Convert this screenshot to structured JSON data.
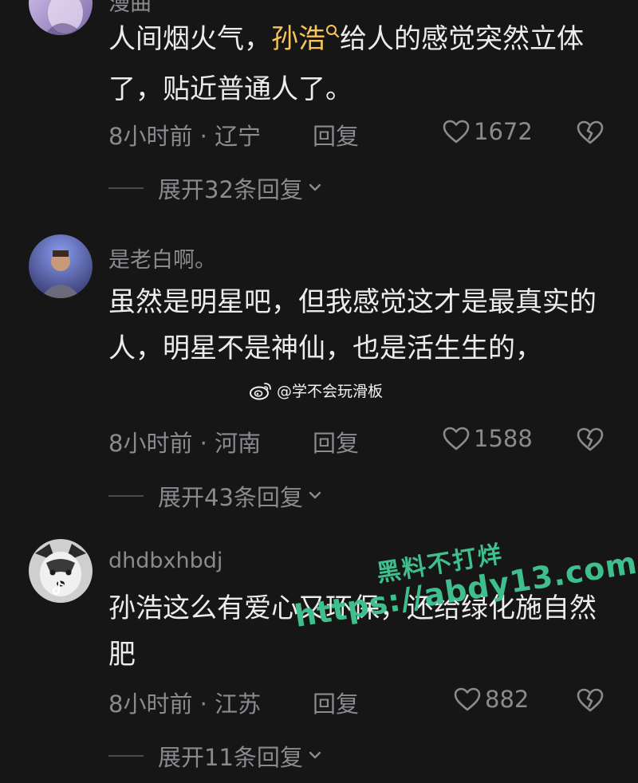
{
  "comments": [
    {
      "username": "漫曲",
      "text_before": "人间烟火气，",
      "highlight": "孙浩",
      "text_after": "给人的感觉突然立体了，贴近普通人了。",
      "time_location": "8小时前 · 辽宁",
      "reply_label": "回复",
      "likes": "1672",
      "expand_label": "展开32条回复",
      "avatar_colors": [
        "#c9b7e8",
        "#8f7bb8"
      ]
    },
    {
      "username": "是老白啊。",
      "text": "虽然是明星吧，但我感觉这才是最真实的人，明星不是神仙，也是活生生的，",
      "time_location": "8小时前 · 河南",
      "reply_label": "回复",
      "likes": "1588",
      "expand_label": "展开43条回复",
      "avatar_colors": [
        "#7e7fd6",
        "#3b3f78"
      ]
    },
    {
      "username": "dhdbxhbdj",
      "text": "孙浩这么有爱心又环保，还给绿化施自然肥",
      "time_location": "8小时前 · 江苏",
      "reply_label": "回复",
      "likes": "882",
      "expand_label": "展开11条回复",
      "avatar_colors": [
        "#d7d7d7",
        "#4a4a4a"
      ]
    }
  ],
  "weibo_watermark": "@学不会玩滑板",
  "site_watermark": {
    "line1": "黑料不打烊",
    "line2": "https://abdy13.com"
  },
  "colors": {
    "background": "#161617",
    "text": "#ececec",
    "muted": "#8a8a8f",
    "highlight": "#f5c55a",
    "watermark": "#3fbf8e"
  },
  "icons": {
    "search": "search-icon",
    "like": "heart-icon",
    "dislike": "broken-heart-icon",
    "expand": "chevron-down-icon",
    "weibo": "weibo-icon",
    "tiktok": "tiktok-icon"
  }
}
